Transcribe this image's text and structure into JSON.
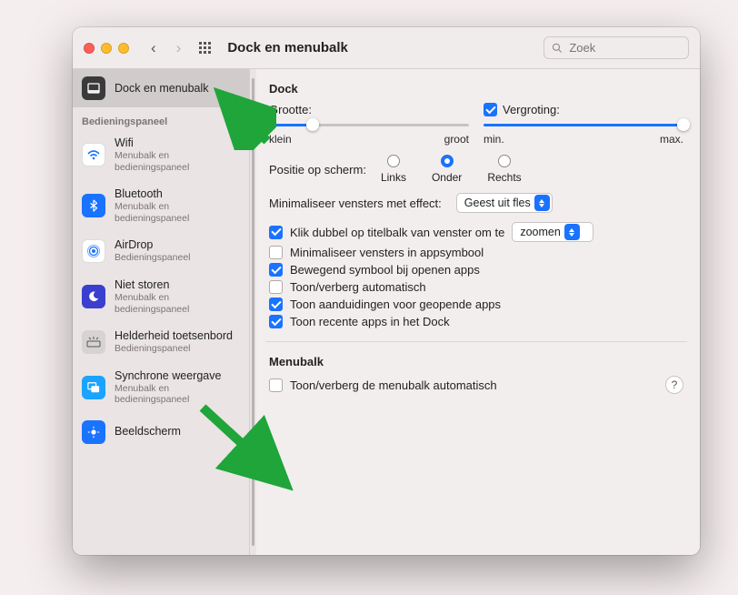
{
  "window": {
    "title": "Dock en menubalk",
    "search_placeholder": "Zoek"
  },
  "sidebar": {
    "header": "Bedieningspaneel",
    "items": [
      {
        "label": "Dock en menubalk",
        "sub": ""
      },
      {
        "label": "Wifi",
        "sub": "Menubalk en bedieningspaneel"
      },
      {
        "label": "Bluetooth",
        "sub": "Menubalk en bedieningspaneel"
      },
      {
        "label": "AirDrop",
        "sub": "Bedieningspaneel"
      },
      {
        "label": "Niet storen",
        "sub": "Menubalk en bedieningspaneel"
      },
      {
        "label": "Helderheid toetsenbord",
        "sub": "Bedieningspaneel"
      },
      {
        "label": "Synchrone weergave",
        "sub": "Menubalk en bedieningspaneel"
      },
      {
        "label": "Beeldscherm",
        "sub": ""
      }
    ]
  },
  "dock": {
    "section": "Dock",
    "size_label": "Grootte:",
    "size_min": "klein",
    "size_max": "groot",
    "size_value_pct": 22,
    "mag_label": "Vergroting:",
    "mag_checked": true,
    "mag_min": "min.",
    "mag_max": "max.",
    "mag_value_pct": 100,
    "position_label": "Positie op scherm:",
    "position_options": [
      "Links",
      "Onder",
      "Rechts"
    ],
    "position_selected": "Onder",
    "minimize_effect_label": "Minimaliseer vensters met effect:",
    "minimize_effect_value": "Geest uit fles",
    "doubleclick_label": "Klik dubbel op titelbalk van venster om te",
    "doubleclick_value": "zoomen",
    "checks": [
      {
        "label": "Klik dubbel op titelbalk van venster om te",
        "checked": true,
        "has_select": true
      },
      {
        "label": "Minimaliseer vensters in appsymbool",
        "checked": false,
        "has_select": false
      },
      {
        "label": "Bewegend symbool bij openen apps",
        "checked": true,
        "has_select": false
      },
      {
        "label": "Toon/verberg automatisch",
        "checked": false,
        "has_select": false
      },
      {
        "label": "Toon aanduidingen voor geopende apps",
        "checked": true,
        "has_select": false
      },
      {
        "label": "Toon recente apps in het Dock",
        "checked": true,
        "has_select": false
      }
    ]
  },
  "menubar": {
    "section": "Menubalk",
    "check": {
      "label": "Toon/verberg de menubalk automatisch",
      "checked": false
    }
  },
  "colors": {
    "accent": "#1a73ff",
    "annotation": "#1fa53a"
  }
}
